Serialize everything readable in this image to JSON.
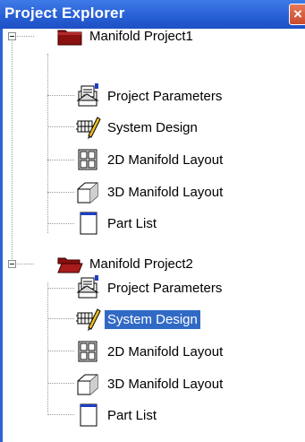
{
  "panel": {
    "title": "Project Explorer",
    "close_icon": "close-icon",
    "colors": {
      "titlebar": "#2a63d6",
      "selection": "#316ac5",
      "folder_project1": "#8b1010",
      "folder_project2": "#8b1010"
    }
  },
  "tree": {
    "projects": [
      {
        "label": "Manifold Project1",
        "icon": "folder-closed-icon",
        "expanded": true,
        "children": [
          {
            "label": "Project Parameters",
            "icon": "project-parameters-icon"
          },
          {
            "label": "System Design",
            "icon": "system-design-icon"
          },
          {
            "label": "2D Manifold Layout",
            "icon": "layout-2d-icon"
          },
          {
            "label": "3D Manifold Layout",
            "icon": "layout-3d-icon"
          },
          {
            "label": "Part List",
            "icon": "part-list-icon"
          }
        ]
      },
      {
        "label": "Manifold Project2",
        "icon": "folder-open-icon",
        "expanded": true,
        "children": [
          {
            "label": "Project Parameters",
            "icon": "project-parameters-icon"
          },
          {
            "label": "System Design",
            "icon": "system-design-icon",
            "selected": true
          },
          {
            "label": "2D Manifold Layout",
            "icon": "layout-2d-icon"
          },
          {
            "label": "3D Manifold Layout",
            "icon": "layout-3d-icon"
          },
          {
            "label": "Part List",
            "icon": "part-list-icon"
          }
        ]
      }
    ]
  }
}
